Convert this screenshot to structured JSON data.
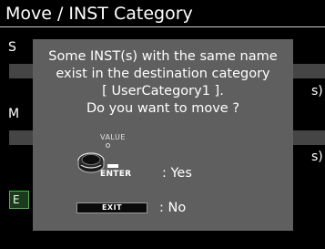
{
  "title": "Move / INST Category",
  "background": {
    "label_s": "S",
    "label_m": "M",
    "suffix_1": "s)",
    "suffix_2": "s)",
    "exec_label": "E"
  },
  "dialog": {
    "message_lines": [
      "Some INST(s) with the same name",
      "exist in the destination category",
      "[ UserCategory1 ].",
      "Do you want to move ?"
    ],
    "value_label": "VALUE",
    "enter_label": "ENTER",
    "yes_text": ": Yes",
    "exit_label": "EXIT",
    "no_text": ": No"
  },
  "colors": {
    "dialog_bg": "#5f5f5f",
    "screen_bg": "#000000",
    "exec_border": "#4cb24c"
  }
}
